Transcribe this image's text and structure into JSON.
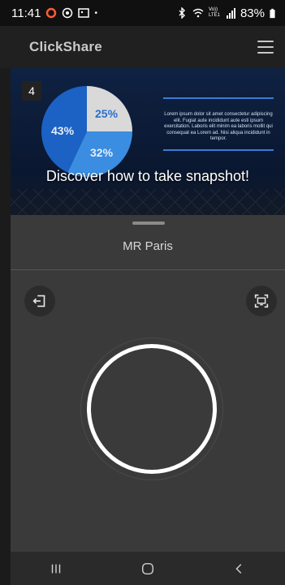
{
  "status_bar": {
    "time": "11:41",
    "battery": "83%",
    "network": "Vo)) LTE1"
  },
  "header": {
    "brand": "ClickShare"
  },
  "banner": {
    "slide_number": "4",
    "caption": "Discover how to take snapshot!",
    "pie": [
      {
        "label": "25%",
        "value": 25,
        "color": "#d9d9d9"
      },
      {
        "label": "32%",
        "value": 32,
        "color": "#3a8de0"
      },
      {
        "label": "43%",
        "value": 43,
        "color": "#1c62c4"
      }
    ],
    "slide_paragraph": "Lorem ipsum dolor sit amet consectetur adipiscing elit. Fugiat aute incididunt aute esti ipsum exercitation. Laboris elit minim ea laboris mollit qui consequat ea Lorem ad. Nisi aliqua incididunt in tempor."
  },
  "panel": {
    "room_name": "MR Paris"
  },
  "icons": {
    "leave": "exit-icon",
    "screen": "screen-capture-icon"
  },
  "colors": {
    "accent": "#1c62c4",
    "panel": "#3a3a3a"
  }
}
